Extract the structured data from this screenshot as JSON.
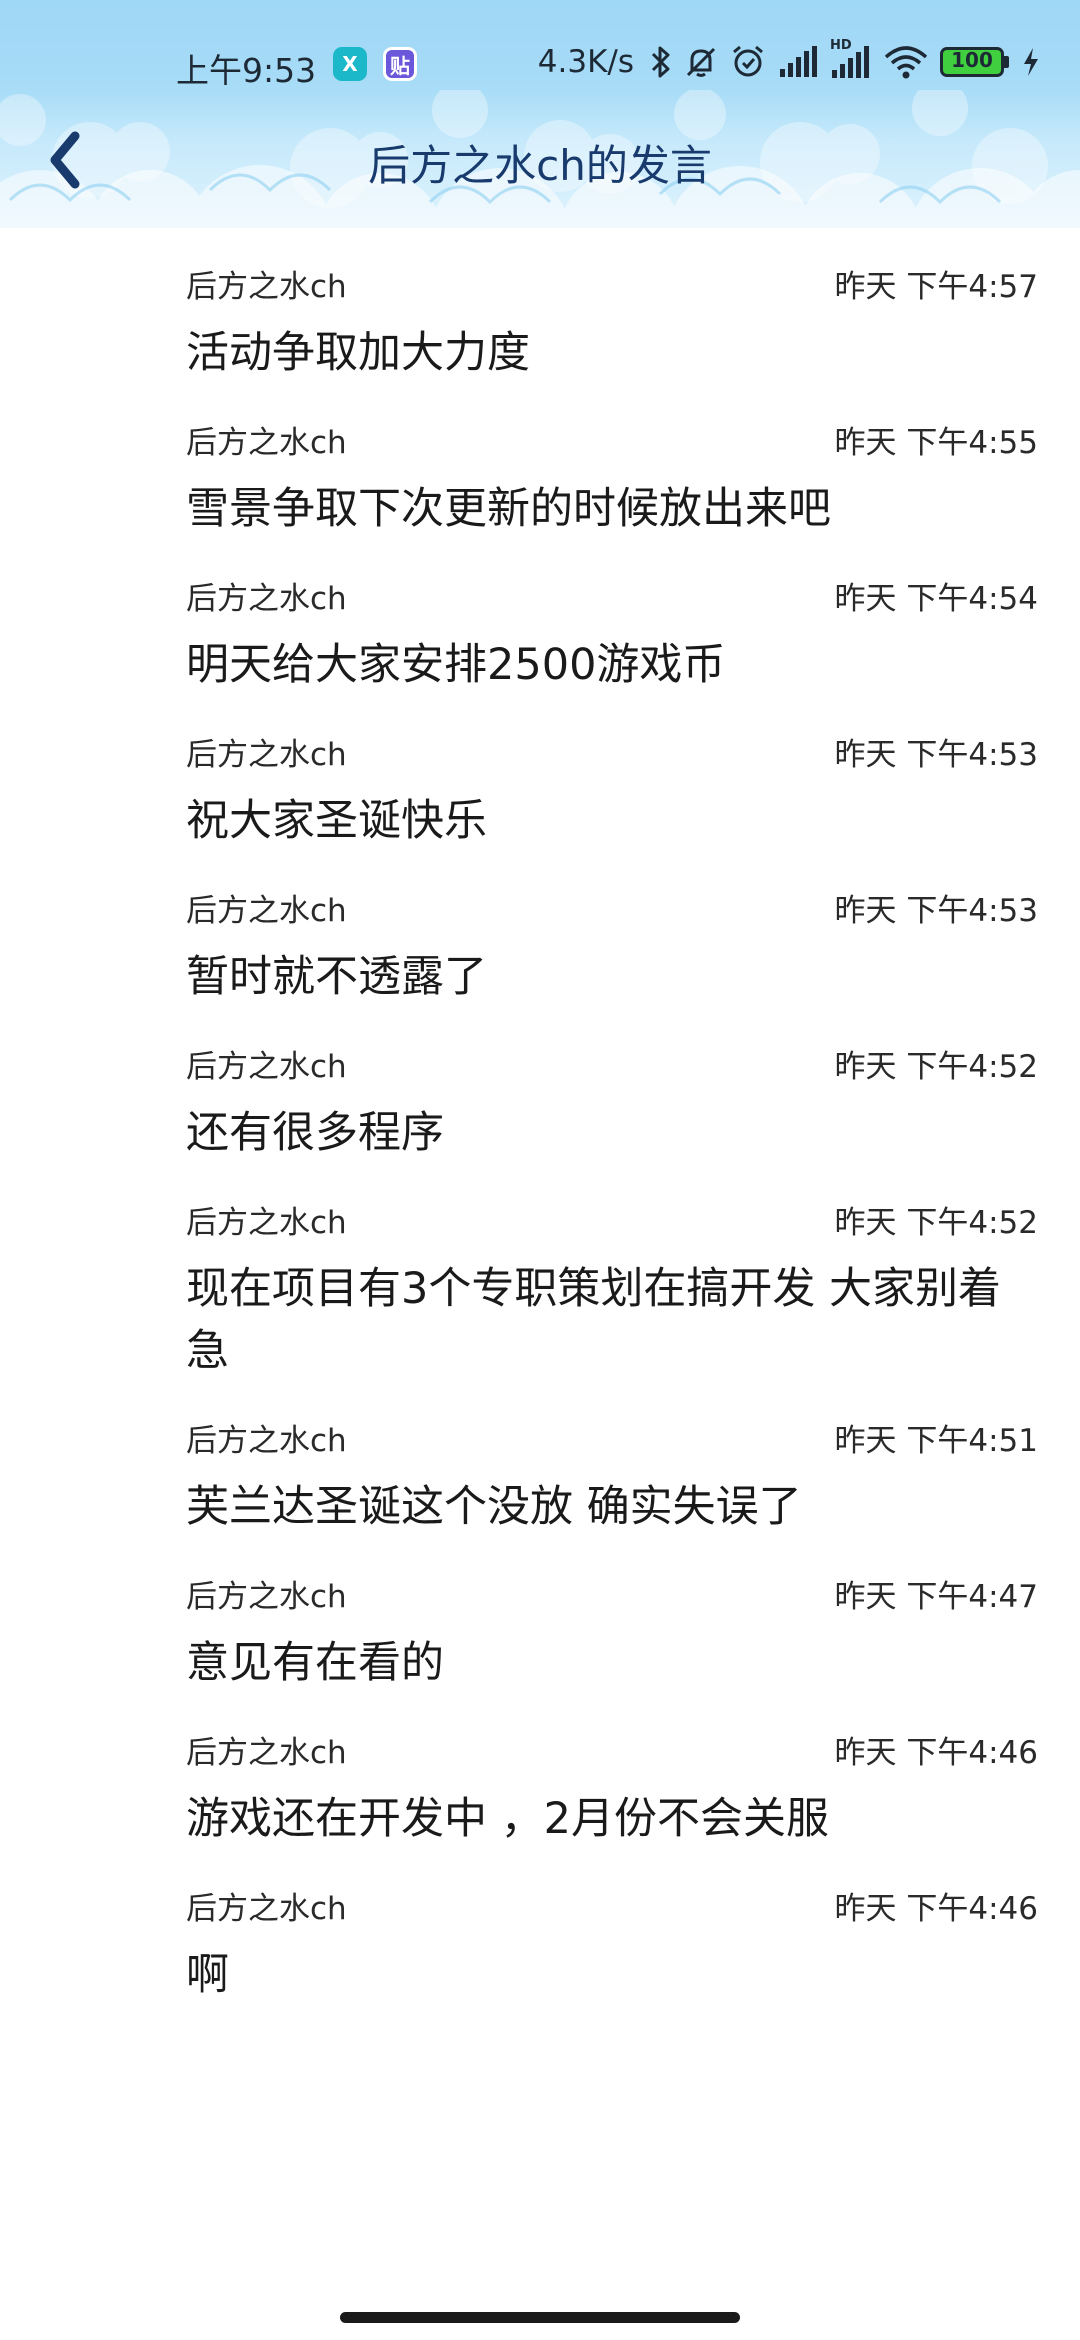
{
  "status_bar": {
    "time": "上午9:53",
    "net_speed": "4.3K/s",
    "battery": "100",
    "icons": [
      "app-x-icon",
      "app-tie-icon",
      "bluetooth-icon",
      "mute-icon",
      "alarm-icon",
      "signal-icon",
      "signal-hd-icon",
      "wifi-icon",
      "battery-icon",
      "charging-icon"
    ],
    "app_x_label": "X",
    "app_tie_label": "贴",
    "hd_label": "HD"
  },
  "header": {
    "title": "后方之水ch的发言",
    "back_icon": "chevron-left-icon"
  },
  "messages": [
    {
      "author": "后方之水ch",
      "time": "昨天 下午4:57",
      "text": "活动争取加大力度"
    },
    {
      "author": "后方之水ch",
      "time": "昨天 下午4:55",
      "text": "雪景争取下次更新的时候放出来吧"
    },
    {
      "author": "后方之水ch",
      "time": "昨天 下午4:54",
      "text": "明天给大家安排2500游戏币"
    },
    {
      "author": "后方之水ch",
      "time": "昨天 下午4:53",
      "text": "祝大家圣诞快乐"
    },
    {
      "author": "后方之水ch",
      "time": "昨天 下午4:53",
      "text": "暂时就不透露了"
    },
    {
      "author": "后方之水ch",
      "time": "昨天 下午4:52",
      "text": "还有很多程序"
    },
    {
      "author": "后方之水ch",
      "time": "昨天 下午4:52",
      "text": "现在项目有3个专职策划在搞开发 大家别着急"
    },
    {
      "author": "后方之水ch",
      "time": "昨天 下午4:51",
      "text": "芙兰达圣诞这个没放 确实失误了"
    },
    {
      "author": "后方之水ch",
      "time": "昨天 下午4:47",
      "text": "意见有在看的"
    },
    {
      "author": "后方之水ch",
      "time": "昨天 下午4:46",
      "text": "游戏还在开发中 ，2月份不会关服"
    },
    {
      "author": "后方之水ch",
      "time": "昨天 下午4:46",
      "text": "啊"
    }
  ],
  "colors": {
    "sky": "#a8dcf7",
    "title": "#183a6c",
    "app_x": "#1bb8c9",
    "app_tie": "#6b57d9",
    "battery_fill": "#3fcf3f"
  }
}
